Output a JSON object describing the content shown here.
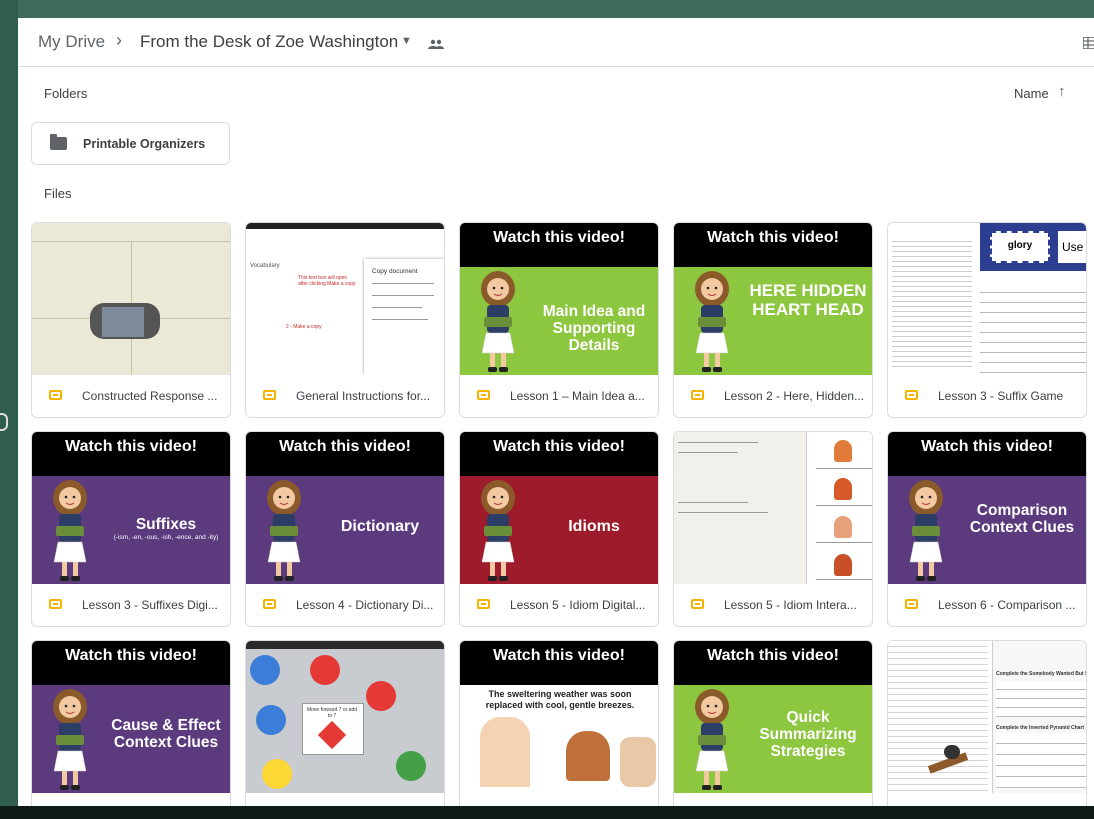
{
  "breadcrumb": {
    "root": "My Drive",
    "separator": "›",
    "current": "From the Desk of Zoe Washington"
  },
  "icons": {
    "dropdown": "chevron-down-icon",
    "shared": "shared-people-icon",
    "view": "grid-view-icon",
    "folder": "shared-folder-icon",
    "file": "slides-icon"
  },
  "sections": {
    "folders": "Folders",
    "files": "Files"
  },
  "sort": {
    "label": "Name",
    "direction_icon": "↑"
  },
  "folders": [
    {
      "name": "Printable Organizers"
    }
  ],
  "files": [
    {
      "name": "Constructed Response ...",
      "thumb": "doc-setting"
    },
    {
      "name": "General Instructions for...",
      "thumb": "doc-copy",
      "thumb_text": {
        "menu": "Vocabulary",
        "dialog_title": "Copy document",
        "note1": "This text box will open after clicking Make a copy",
        "note2": "2 - Make a copy"
      }
    },
    {
      "name": "Lesson 1 – Main Idea a...",
      "thumb": "video",
      "header": "Watch this video!",
      "title": "Main Idea and Supporting Details",
      "bg": "#8dc63f"
    },
    {
      "name": "Lesson 2 - Here, Hidden...",
      "thumb": "video",
      "header": "Watch this video!",
      "title": "HERE HIDDEN HEART HEAD",
      "bg": "#8dc63f"
    },
    {
      "name": "Lesson 3 - Suffix Game",
      "thumb": "doc-suffix",
      "thumb_text": {
        "card1": "glory",
        "card2": "Use"
      }
    },
    {
      "name": "Lesson 3 - Suffixes Digi...",
      "thumb": "video",
      "header": "Watch this video!",
      "title": "Suffixes",
      "subtitle": "(-ism, -en, -ous, -ish, -ence, and -ity)",
      "bg": "#5c3a7e"
    },
    {
      "name": "Lesson 4 - Dictionary Di...",
      "thumb": "video",
      "header": "Watch this video!",
      "title": "Dictionary",
      "bg": "#5c3a7e"
    },
    {
      "name": "Lesson 5 - Idiom Digital...",
      "thumb": "video",
      "header": "Watch this video!",
      "title": "Idioms",
      "bg": "#9e1b2b"
    },
    {
      "name": "Lesson 5 - Idiom Intera...",
      "thumb": "doc-idiom"
    },
    {
      "name": "Lesson 6 - Comparison ...",
      "thumb": "video",
      "header": "Watch this video!",
      "title": "Comparison Context Clues",
      "bg": "#5c3a7e"
    },
    {
      "name": "",
      "thumb": "video",
      "header": "Watch this video!",
      "title": "Cause & Effect Context Clues",
      "bg": "#5c3a7e"
    },
    {
      "name": "",
      "thumb": "doc-game",
      "thumb_text": {
        "card": "Move forward 7 or add to 7"
      }
    },
    {
      "name": "",
      "thumb": "video-sentence",
      "header": "Watch this video!",
      "title": "The sweltering weather was soon replaced with cool, gentle breezes."
    },
    {
      "name": "",
      "thumb": "video",
      "header": "Watch this video!",
      "title": "Quick Summarizing Strategies",
      "bg": "#8dc63f"
    },
    {
      "name": "",
      "thumb": "doc-summary",
      "thumb_text": {
        "heading": "Complete the Somebody Wanted But So Chart",
        "heading2": "Complete the Inverted Pyramid Chart"
      }
    }
  ],
  "colors": {
    "purple": "#5c3a7e",
    "green": "#8dc63f",
    "red": "#9e1b2b",
    "slides_yellow": "#f4b400"
  }
}
